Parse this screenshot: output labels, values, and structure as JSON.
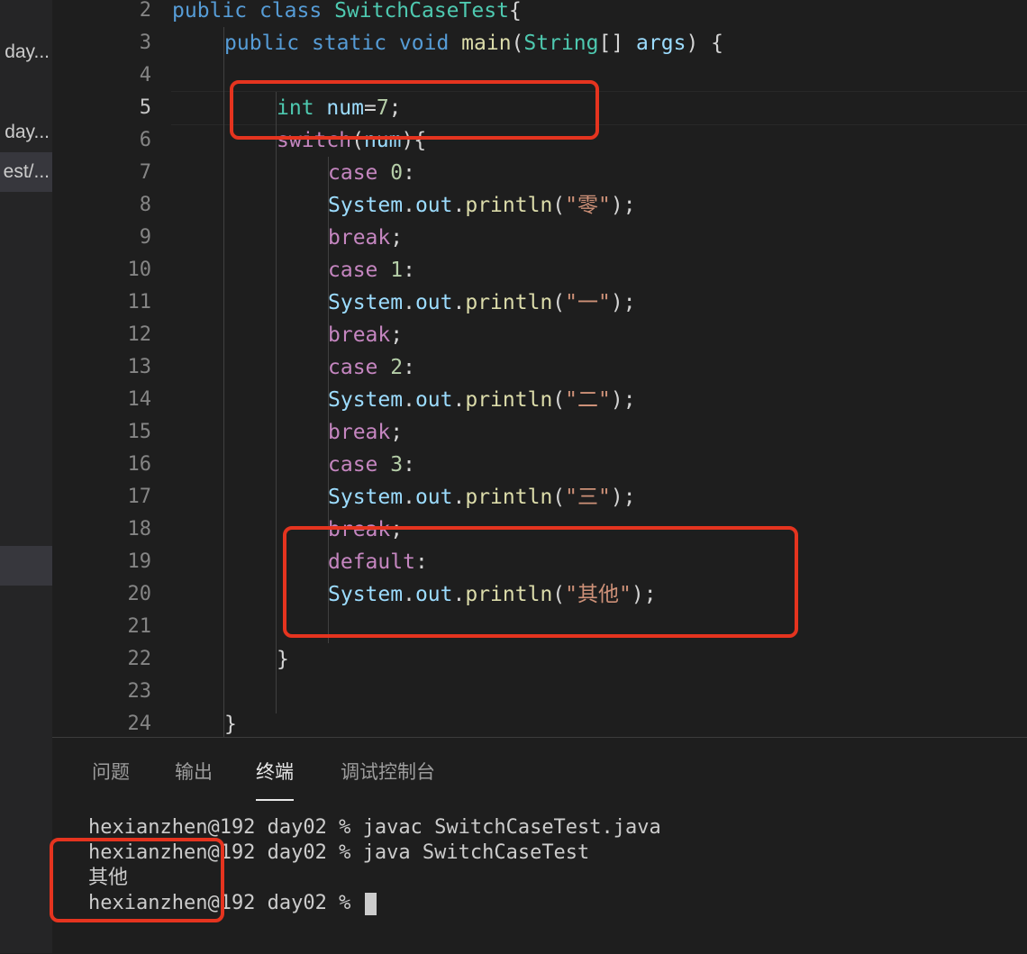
{
  "sidebar": {
    "items": [
      {
        "label": "day..."
      },
      {
        "label": "day..."
      },
      {
        "label": "est/..."
      }
    ]
  },
  "editor": {
    "line_numbers": [
      "2",
      "3",
      "4",
      "5",
      "6",
      "7",
      "8",
      "9",
      "10",
      "11",
      "12",
      "13",
      "14",
      "15",
      "16",
      "17",
      "18",
      "19",
      "20",
      "21",
      "22",
      "23",
      "24"
    ],
    "active_line": "5"
  },
  "panel": {
    "tabs": [
      {
        "label": "问题"
      },
      {
        "label": "输出"
      },
      {
        "label": "终端",
        "active": true
      },
      {
        "label": "调试控制台"
      }
    ],
    "terminal_lines": [
      "hexianzhen@192 day02 % javac SwitchCaseTest.java",
      "hexianzhen@192 day02 % java SwitchCaseTest",
      "其他",
      "hexianzhen@192 day02 % "
    ]
  },
  "colors": {
    "annotation": "#e5341f",
    "keyword": "#569cd6",
    "type": "#4ec9b0",
    "control": "#c586c0",
    "string": "#ce9178"
  }
}
